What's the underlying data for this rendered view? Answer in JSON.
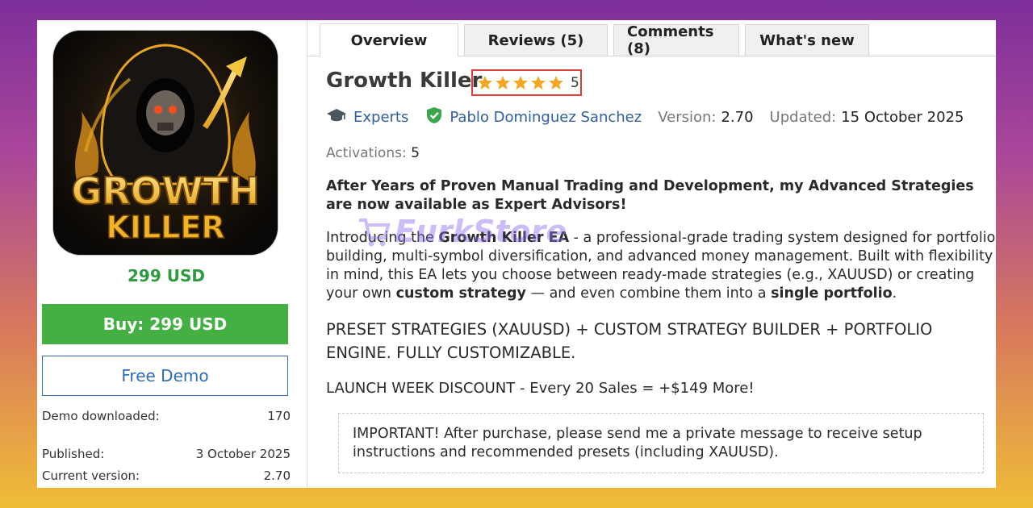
{
  "product": {
    "logo_line1": "GROWTH",
    "logo_line2": "KILLER",
    "price": "299 USD",
    "buy_label": "Buy: 299 USD",
    "demo_label": "Free Demo",
    "info": [
      {
        "label": "Demo downloaded:",
        "value": "170"
      },
      {
        "label": "Published:",
        "value": "3 October 2025"
      },
      {
        "label": "Current version:",
        "value": "2.70"
      }
    ]
  },
  "tabs": [
    "Overview",
    "Reviews (5)",
    "Comments (8)",
    "What's new"
  ],
  "active_tab": "Overview",
  "header": {
    "title": "Growth Killer",
    "rating": "5",
    "rating_stars": 5,
    "category": "Experts",
    "author": "Pablo Dominguez Sanchez",
    "version_label": "Version:",
    "version": "2.70",
    "updated_label": "Updated:",
    "updated": "15 October 2025",
    "activations_label": "Activations:",
    "activations": "5"
  },
  "description": {
    "intro": "After Years of Proven Manual Trading and Development, my Advanced Strategies are now available as Expert Advisors!",
    "p1_a": "Introducing the ",
    "p1_b": "Growth Killer EA",
    "p1_c": " - a professional-grade trading system designed for portfolio building, multi-symbol diversification, and advanced money management. Built with flexibility in mind, this EA lets you choose between ready-made strategies (e.g., XAUUSD) or creating your own ",
    "p1_d": "custom strategy",
    "p1_e": " — and even combine them into a ",
    "p1_f": "single portfolio",
    "p1_g": ".",
    "preset": "PRESET STRATEGIES (XAUUSD) + CUSTOM STRATEGY BUILDER + PORTFOLIO ENGINE. FULLY CUSTOMIZABLE.",
    "launch": "LAUNCH WEEK DISCOUNT - Every 20 Sales = +$149 More!",
    "important": "IMPORTANT! After purchase, please send me a private message to receive setup instructions and recommended presets (including XAUUSD)."
  },
  "watermark": "EurkStore",
  "colors": {
    "price_green": "#2e9b3e",
    "buy_green": "#44b043",
    "link_blue": "#2f5f9e",
    "star_gold": "#f5a623",
    "rating_border": "#e23b3b"
  }
}
